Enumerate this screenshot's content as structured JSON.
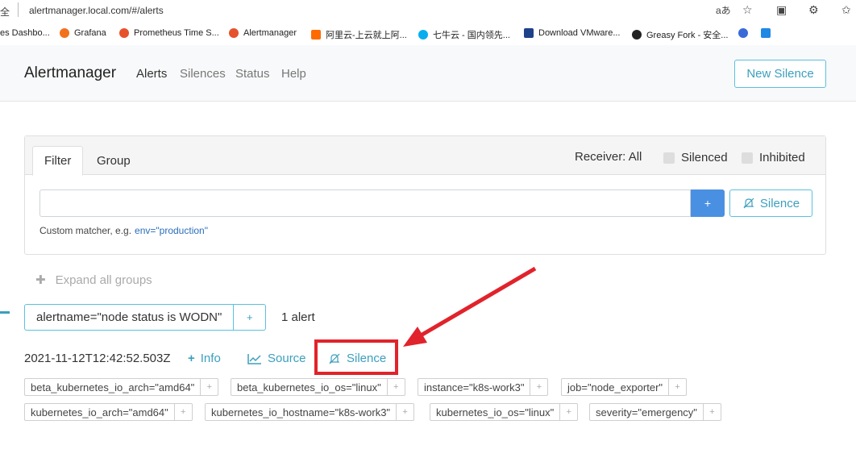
{
  "browser": {
    "security_text": "全",
    "url": "alertmanager.local.com/#/alerts",
    "bookmarks": [
      {
        "label": "es Dashbo...",
        "color": "#ffffff"
      },
      {
        "label": "Grafana",
        "color": "#f2711c"
      },
      {
        "label": "Prometheus Time S...",
        "color": "#e6522c"
      },
      {
        "label": "Alertmanager",
        "color": "#e6522c"
      },
      {
        "label": "阿里云-上云就上阿...",
        "color": "#ff6a00"
      },
      {
        "label": "七牛云 - 国内领先...",
        "color": "#06aeef"
      },
      {
        "label": "Download VMware...",
        "color": "#1d428a"
      },
      {
        "label": "Greasy Fork - 安全...",
        "color": "#222222"
      },
      {
        "label": "",
        "color": "#3a6ad8"
      },
      {
        "label": "",
        "color": "#1e88e5"
      }
    ]
  },
  "navbar": {
    "brand": "Alertmanager",
    "links": [
      "Alerts",
      "Silences",
      "Status",
      "Help"
    ],
    "new_silence": "New Silence"
  },
  "filter": {
    "tabs": [
      "Filter",
      "Group"
    ],
    "receiver": "Receiver: All",
    "silenced": "Silenced",
    "inhibited": "Inhibited",
    "input_value": "",
    "plus": "+",
    "silence_button": "Silence",
    "hint": "Custom matcher, e.g.",
    "hint_example": "env=\"production\""
  },
  "expand_all": "Expand all groups",
  "group": {
    "label": "alertname=\"node status is WODN\"",
    "add": "+",
    "count": "1 alert"
  },
  "alert": {
    "timestamp": "2021-11-12T12:42:52.503Z",
    "info": "Info",
    "source": "Source",
    "silence": "Silence",
    "labels_row1": [
      "beta_kubernetes_io_arch=\"amd64\"",
      "beta_kubernetes_io_os=\"linux\"",
      "instance=\"k8s-work3\"",
      "job=\"node_exporter\""
    ],
    "labels_row2": [
      "kubernetes_io_arch=\"amd64\"",
      "kubernetes_io_hostname=\"k8s-work3\"",
      "kubernetes_io_os=\"linux\"",
      "severity=\"emergency\""
    ]
  },
  "colors": {
    "accent": "#5bc0de",
    "primary": "#4a90e2",
    "annotation": "#e1232b"
  }
}
